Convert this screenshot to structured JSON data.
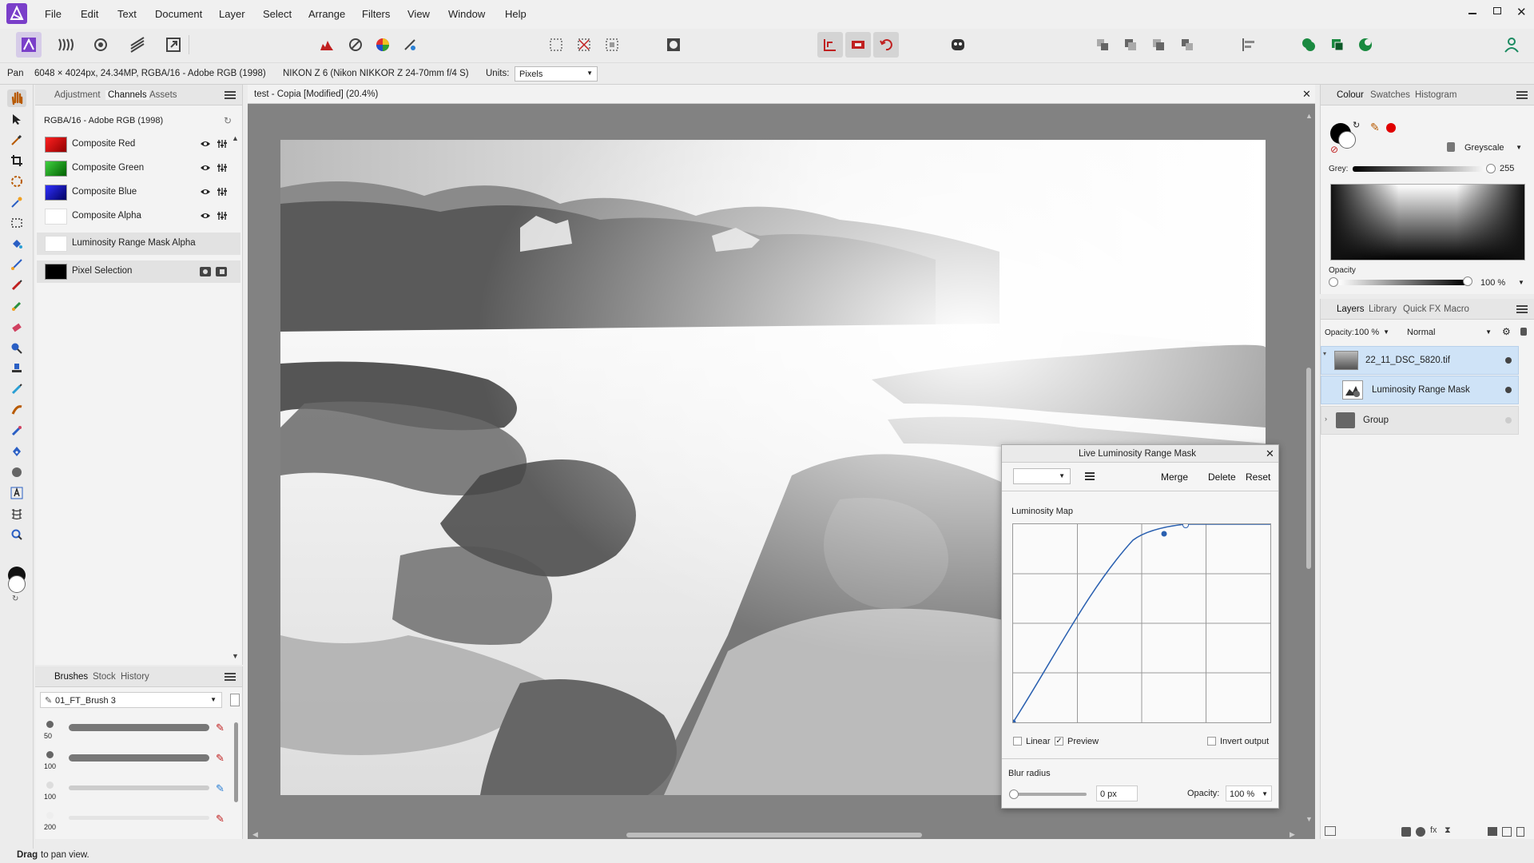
{
  "app": {
    "name": "Affinity Photo"
  },
  "menu": [
    "File",
    "Edit",
    "Text",
    "Document",
    "Layer",
    "Select",
    "Arrange",
    "Filters",
    "View",
    "Window",
    "Help"
  ],
  "context": {
    "tool": "Pan",
    "image_info": "6048 × 4024px, 24.34MP, RGBA/16 - Adobe RGB (1998)",
    "camera": "NIKON Z 6 (Nikon NIKKOR Z 24-70mm f/4 S)",
    "units_label": "Units:",
    "units_value": "Pixels"
  },
  "left_panel": {
    "tabs": [
      "Adjustment",
      "Channels",
      "Assets"
    ],
    "active_tab": "Channels",
    "profile": "RGBA/16 - Adobe RGB (1998)",
    "channels": [
      {
        "label": "Composite Red",
        "color": "#e00000"
      },
      {
        "label": "Composite Green",
        "color": "#00b000"
      },
      {
        "label": "Composite Blue",
        "color": "#0010d0"
      },
      {
        "label": "Composite Alpha",
        "color": "#ffffff"
      },
      {
        "label": "Luminosity Range Mask Alpha",
        "color": "#ffffff"
      },
      {
        "label": "Pixel Selection",
        "color": "#000000"
      }
    ]
  },
  "brushes_panel": {
    "tabs": [
      "Brushes",
      "Stock",
      "History"
    ],
    "active_tab": "Brushes",
    "category": "01_FT_Brush 3",
    "brushes": [
      {
        "size": "50"
      },
      {
        "size": "100"
      },
      {
        "size": "100"
      },
      {
        "size": "200"
      }
    ]
  },
  "document": {
    "title": "test - Copia [Modified] (20.4%)"
  },
  "dialog": {
    "title": "Live Luminosity Range Mask",
    "merge": "Merge",
    "delete": "Delete",
    "reset": "Reset",
    "map_label": "Luminosity Map",
    "linear": "Linear",
    "preview": "Preview",
    "invert": "Invert output",
    "blur_label": "Blur radius",
    "blur_value": "0 px",
    "opacity_label": "Opacity:",
    "opacity_value": "100 %",
    "linear_checked": false,
    "preview_checked": true,
    "invert_checked": false
  },
  "colour_panel": {
    "tabs": [
      "Colour",
      "Swatches",
      "Histogram"
    ],
    "active_tab": "Colour",
    "mode": "Greyscale",
    "grey_label": "Grey:",
    "grey_value": "255",
    "opacity_label": "Opacity",
    "opacity_value": "100 %"
  },
  "layers_panel": {
    "tabs": [
      "Layers",
      "Library",
      "Quick FX",
      "Macro"
    ],
    "active_tab": "Layers",
    "opacity_label": "Opacity:",
    "opacity_value": "100 %",
    "blend_mode": "Normal",
    "layers": [
      {
        "name": "22_11_DSC_5820.tif"
      },
      {
        "name": "Luminosity Range Mask"
      },
      {
        "name": "Group"
      }
    ]
  },
  "status": {
    "bold": "Drag",
    "rest": " to pan view."
  },
  "colors": {
    "accent": "#2a7fd4",
    "selected_row": "#cfe3f7",
    "brand": "#7a3fc9"
  }
}
